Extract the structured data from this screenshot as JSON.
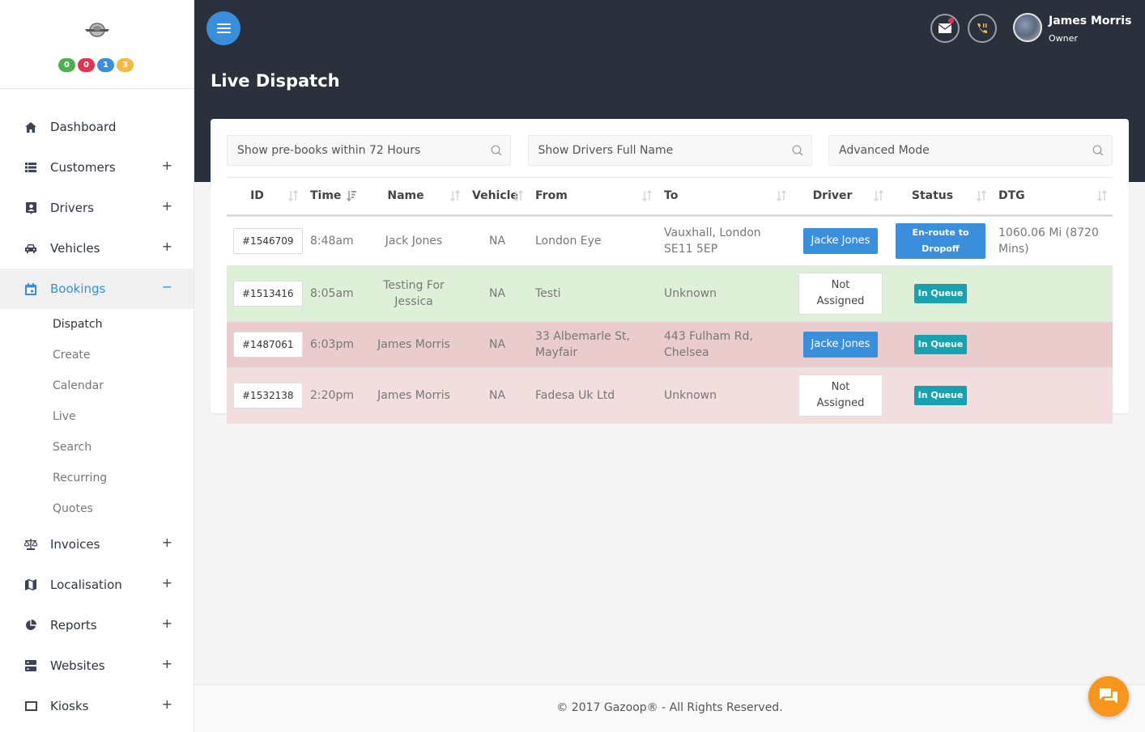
{
  "brand": {
    "badges": [
      {
        "value": "0",
        "color": "#4caf50"
      },
      {
        "value": "0",
        "color": "#e8314f"
      },
      {
        "value": "1",
        "color": "#3a8fdd"
      },
      {
        "value": "3",
        "color": "#f5b942"
      }
    ]
  },
  "sidebar": {
    "items": [
      {
        "label": "Dashboard",
        "icon": "home-icon",
        "toggle": ""
      },
      {
        "label": "Customers",
        "icon": "list-icon",
        "toggle": "+"
      },
      {
        "label": "Drivers",
        "icon": "id-badge-icon",
        "toggle": "+"
      },
      {
        "label": "Vehicles",
        "icon": "car-icon",
        "toggle": "+"
      },
      {
        "label": "Bookings",
        "icon": "calendar-icon",
        "toggle": "−"
      },
      {
        "label": "Invoices",
        "icon": "balance-scale-icon",
        "toggle": "+"
      },
      {
        "label": "Localisation",
        "icon": "map-icon",
        "toggle": "+"
      },
      {
        "label": "Reports",
        "icon": "pie-chart-icon",
        "toggle": "+"
      },
      {
        "label": "Websites",
        "icon": "server-icon",
        "toggle": "+"
      },
      {
        "label": "Kiosks",
        "icon": "monitor-icon",
        "toggle": "+"
      }
    ],
    "bookings_sub": [
      "Dispatch",
      "Create",
      "Calendar",
      "Live",
      "Search",
      "Recurring",
      "Quotes"
    ]
  },
  "header": {
    "title": "Live Dispatch",
    "user_name": "James Morris",
    "user_role": "Owner"
  },
  "filters": {
    "prebooks_placeholder": "Show pre-books within 72 Hours",
    "drivers_placeholder": "Show Drivers Full Name",
    "advanced_placeholder": "Advanced Mode"
  },
  "table": {
    "headers": [
      "ID",
      "Time",
      "Name",
      "Vehicle",
      "From",
      "To",
      "Driver",
      "Status",
      "DTG"
    ],
    "rows": [
      {
        "id": "#1546709",
        "time": "8:48am",
        "name": "Jack Jones",
        "vehicle": "NA",
        "from": "London Eye",
        "to": "Vauxhall, London SE11 5EP",
        "driver": "Jacke Jones",
        "status": "En-route to Dropoff",
        "dtg": "1060.06 Mi (8720 Mins)"
      },
      {
        "id": "#1513416",
        "time": "8:05am",
        "name": "Testing For Jessica",
        "vehicle": "NA",
        "from": "Testi",
        "to": "Unknown",
        "driver": "Not Assigned",
        "status": "In Queue",
        "dtg": ""
      },
      {
        "id": "#1487061",
        "time": "6:03pm",
        "name": "James Morris",
        "vehicle": "NA",
        "from": "33 Albemarle St, Mayfair",
        "to": "443 Fulham Rd, Chelsea",
        "driver": "Jacke Jones",
        "status": "In Queue",
        "dtg": ""
      },
      {
        "id": "#1532138",
        "time": "2:20pm",
        "name": "James Morris",
        "vehicle": "NA",
        "from": "Fadesa Uk Ltd",
        "to": "Unknown",
        "driver": "Not Assigned",
        "status": "In Queue",
        "dtg": ""
      }
    ]
  },
  "footer": {
    "text": "© 2017 Gazoop® - All Rights Reserved."
  },
  "colors": {
    "accent": "#3a8fdd",
    "header_bg": "#2b313c",
    "queue": "#17a2b0",
    "chat": "#f7951d"
  }
}
